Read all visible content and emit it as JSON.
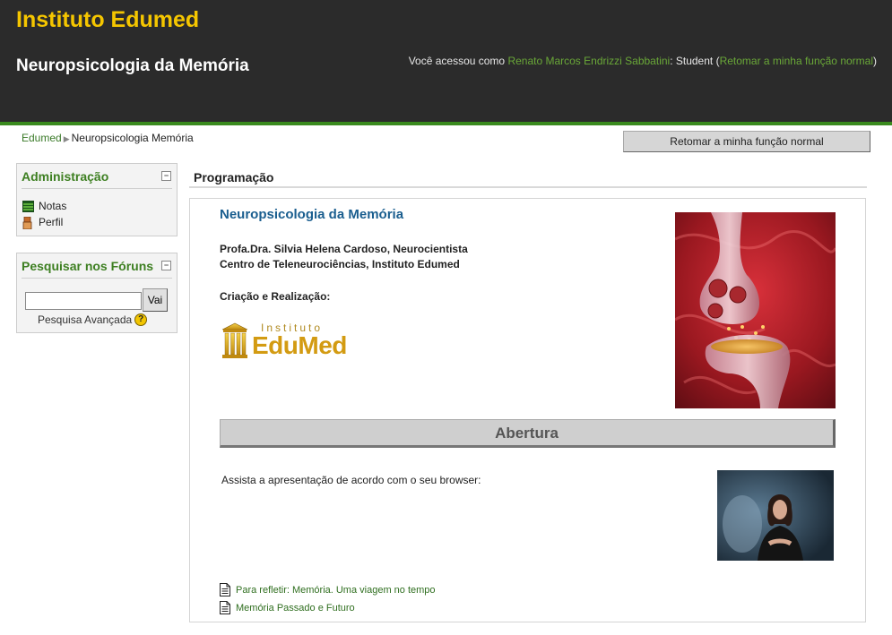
{
  "header": {
    "site_name": "Instituto Edumed",
    "course_title": "Neuropsicologia da Memória",
    "login_prefix": "Você acessou como ",
    "user_name": "Renato Marcos Endrizzi Sabbatini",
    "role_text": ": Student (",
    "return_role_link": "Retomar a minha função normal",
    "close_paren": ")"
  },
  "breadcrumb": {
    "home": "Edumed",
    "separator": "▶",
    "current": "Neuropsicologia Memória"
  },
  "return_button_label": "Retomar a minha função normal",
  "admin_block": {
    "title": "Administração",
    "collapse": "−",
    "items": [
      {
        "label": "Notas",
        "icon": "grades-icon"
      },
      {
        "label": "Perfil",
        "icon": "user-icon"
      }
    ]
  },
  "search_block": {
    "title": "Pesquisar nos Fóruns",
    "collapse": "−",
    "input_value": "",
    "go_label": "Vai",
    "advanced_label": "Pesquisa Avançada",
    "help_glyph": "?"
  },
  "main": {
    "section_heading": "Programação",
    "title": "Neuropsicologia da Memória",
    "author_line1": "Profa.Dra. Silvia Helena Cardoso, Neurocientista",
    "author_line2": "Centro de Teleneurociências, Instituto Edumed",
    "credits_label": "Criação e Realização:",
    "logo_top": "Instituto",
    "logo_main": "EduMed",
    "opening_label": "Abertura",
    "presentation_text": "Assista a apresentação de acordo com o seu browser:",
    "resources": [
      {
        "label": "Para refletir: Memória. Uma viagem no tempo"
      },
      {
        "label": "Memória Passado e Futuro"
      }
    ]
  },
  "colors": {
    "header_bg": "#2b2b2b",
    "site_name": "#f5c600",
    "accent_green": "#3a8a1e",
    "link_green": "#3d7f21",
    "title_blue": "#1a5e8f"
  }
}
